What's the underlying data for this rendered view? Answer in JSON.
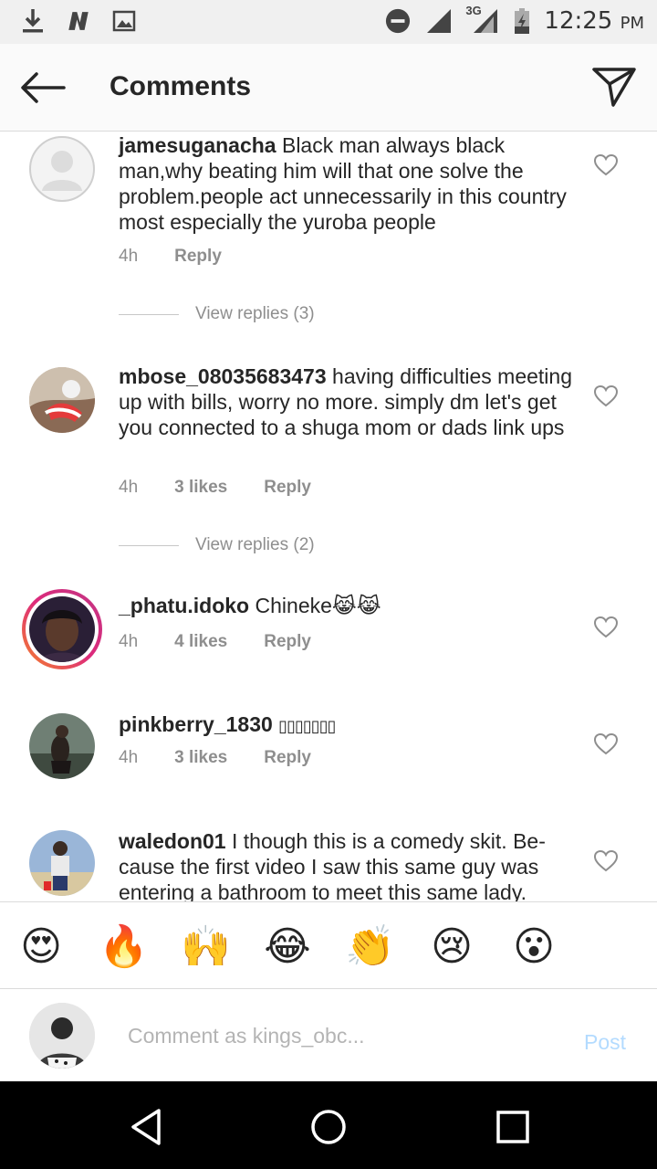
{
  "status_bar": {
    "icons": [
      "download-icon",
      "n-app-icon",
      "image-icon",
      "do-not-disturb-icon",
      "signal-icon",
      "signal-3g-icon",
      "battery-charging-icon"
    ],
    "network_label": "3G",
    "time": "12:25",
    "ampm": "PM"
  },
  "header": {
    "title": "Comments",
    "back_icon": "arrow-left-icon",
    "send_icon": "paper-plane-icon"
  },
  "comments": [
    {
      "username": "jamesuganacha",
      "text": "Black man always black man,why beating him will that one solve the problem.people act unnecessarily in this country most especially the yuroba people",
      "time": "4h",
      "likes": "",
      "reply": "Reply",
      "view_replies": "View replies (3)"
    },
    {
      "username": "mbose_08035683473",
      "text": "having difficulties meeting up with bills, worry no more. simply dm let's get you connected to a shuga mom or dads link ups",
      "time": "4h",
      "likes": "3 likes",
      "reply": "Reply",
      "view_replies": "View replies (2)"
    },
    {
      "username": "_phatu.idoko",
      "text": "Chineke😹😹",
      "time": "4h",
      "likes": "4 likes",
      "reply": "Reply"
    },
    {
      "username": "pinkberry_1830",
      "text": "▯▯▯▯▯▯▯",
      "time": "4h",
      "likes": "3 likes",
      "reply": "Reply"
    },
    {
      "username": "waledon01",
      "text": "I though this is a comedy skit. Be-cause the first video I saw this same guy was entering a bathroom to meet this same lady."
    }
  ],
  "emoji_bar": [
    "😍",
    "🔥",
    "🙌",
    "😂",
    "👏",
    "😢",
    "😮"
  ],
  "comment_input": {
    "placeholder": "Comment as kings_obc...",
    "post_label": "Post"
  },
  "colors": {
    "post_disabled": "#b3dbff",
    "meta_gray": "#8e8e8e",
    "story_ring": "#dd2a7b"
  }
}
